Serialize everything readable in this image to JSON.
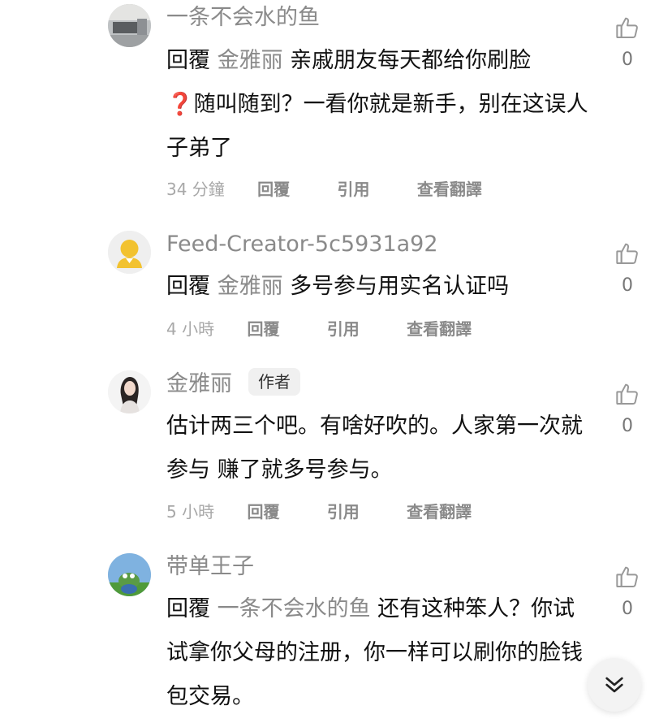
{
  "comments": [
    {
      "username": "一条不会水的鱼",
      "reply_prefix": "回覆",
      "mention": "金雅丽",
      "text_after_mention": " 亲戚朋友每天都给你刷脸",
      "emoji": "❓",
      "text_line_rest": "随叫随到？一看你就是新手，别在这误人子弟了",
      "time": "34 分鐘",
      "actions": [
        "回覆",
        "引用",
        "查看翻譯"
      ],
      "likes": "0"
    },
    {
      "username": "Feed-Creator-5c5931a92",
      "reply_prefix": "回覆",
      "mention": "金雅丽",
      "text": " 多号参与用实名认证吗",
      "time": "4 小時",
      "actions": [
        "回覆",
        "引用",
        "查看翻譯"
      ],
      "likes": "0"
    },
    {
      "username": "金雅丽",
      "badge": "作者",
      "text": "估计两三个吧。有啥好吹的。人家第一次就参与 赚了就多号参与。",
      "time": "5 小時",
      "actions": [
        "回覆",
        "引用",
        "查看翻譯"
      ],
      "likes": "0"
    },
    {
      "username": "带单王子",
      "reply_prefix": "回覆",
      "mention": "一条不会水的鱼",
      "text": " 还有这种笨人？你试试拿你父母的注册，你一样可以刷你的脸钱包交易。",
      "likes": "0"
    }
  ],
  "icons": {
    "like": "thumbs-up-icon",
    "scroll_down": "double-chevron-down-icon"
  }
}
